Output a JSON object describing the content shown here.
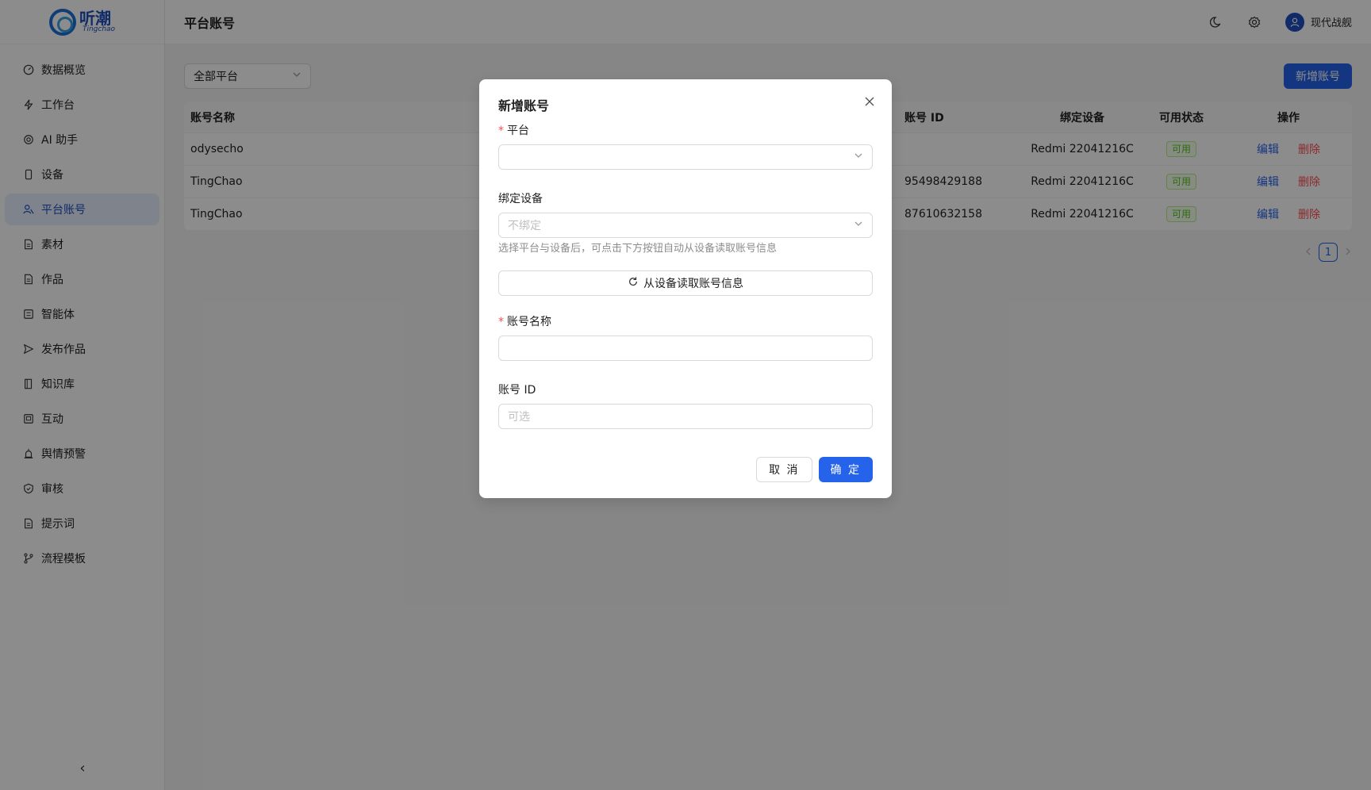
{
  "app": {
    "logo_cn": "听潮",
    "logo_en": "Tingchao"
  },
  "sidebar": {
    "items": [
      {
        "label": "数据概览",
        "icon": "dashboard-icon"
      },
      {
        "label": "工作台",
        "icon": "lightning-icon"
      },
      {
        "label": "AI 助手",
        "icon": "ai-icon"
      },
      {
        "label": "设备",
        "icon": "phone-icon"
      },
      {
        "label": "平台账号",
        "icon": "users-icon",
        "active": true
      },
      {
        "label": "素材",
        "icon": "file-icon"
      },
      {
        "label": "作品",
        "icon": "file-icon"
      },
      {
        "label": "智能体",
        "icon": "robot-icon"
      },
      {
        "label": "发布作品",
        "icon": "send-icon"
      },
      {
        "label": "知识库",
        "icon": "book-icon"
      },
      {
        "label": "互动",
        "icon": "chat-icon"
      },
      {
        "label": "舆情预警",
        "icon": "alarm-icon"
      },
      {
        "label": "审核",
        "icon": "shield-icon"
      },
      {
        "label": "提示词",
        "icon": "file-icon"
      },
      {
        "label": "流程模板",
        "icon": "branch-icon"
      }
    ],
    "collapse_glyph": "‹"
  },
  "header": {
    "title": "平台账号",
    "user_name": "现代战舰"
  },
  "toolbar": {
    "platform_filter": "全部平台",
    "add_label": "新增账号"
  },
  "table": {
    "columns": [
      "账号名称",
      "账号 ID",
      "绑定设备",
      "可用状态",
      "操作"
    ],
    "rows": [
      {
        "name": "odysecho",
        "id": "",
        "device": "Redmi 22041216C",
        "status": "可用",
        "edit": "编辑",
        "delete": "删除"
      },
      {
        "name": "TingChao",
        "id": "95498429188",
        "device": "Redmi 22041216C",
        "status": "可用",
        "edit": "编辑",
        "delete": "删除"
      },
      {
        "name": "TingChao",
        "id": "87610632158",
        "device": "Redmi 22041216C",
        "status": "可用",
        "edit": "编辑",
        "delete": "删除"
      }
    ]
  },
  "pagination": {
    "current": "1"
  },
  "modal": {
    "title": "新增账号",
    "platform_label": "平台",
    "platform_value": "",
    "device_label": "绑定设备",
    "device_placeholder": "不绑定",
    "device_hint": "选择平台与设备后，可点击下方按钮自动从设备读取账号信息",
    "read_button": "从设备读取账号信息",
    "name_label": "账号名称",
    "name_value": "",
    "id_label": "账号 ID",
    "id_placeholder": "可选",
    "cancel": "取 消",
    "ok": "确 定"
  },
  "colors": {
    "primary": "#2563eb",
    "danger": "#ff4d4f",
    "success": "#52c41a"
  }
}
